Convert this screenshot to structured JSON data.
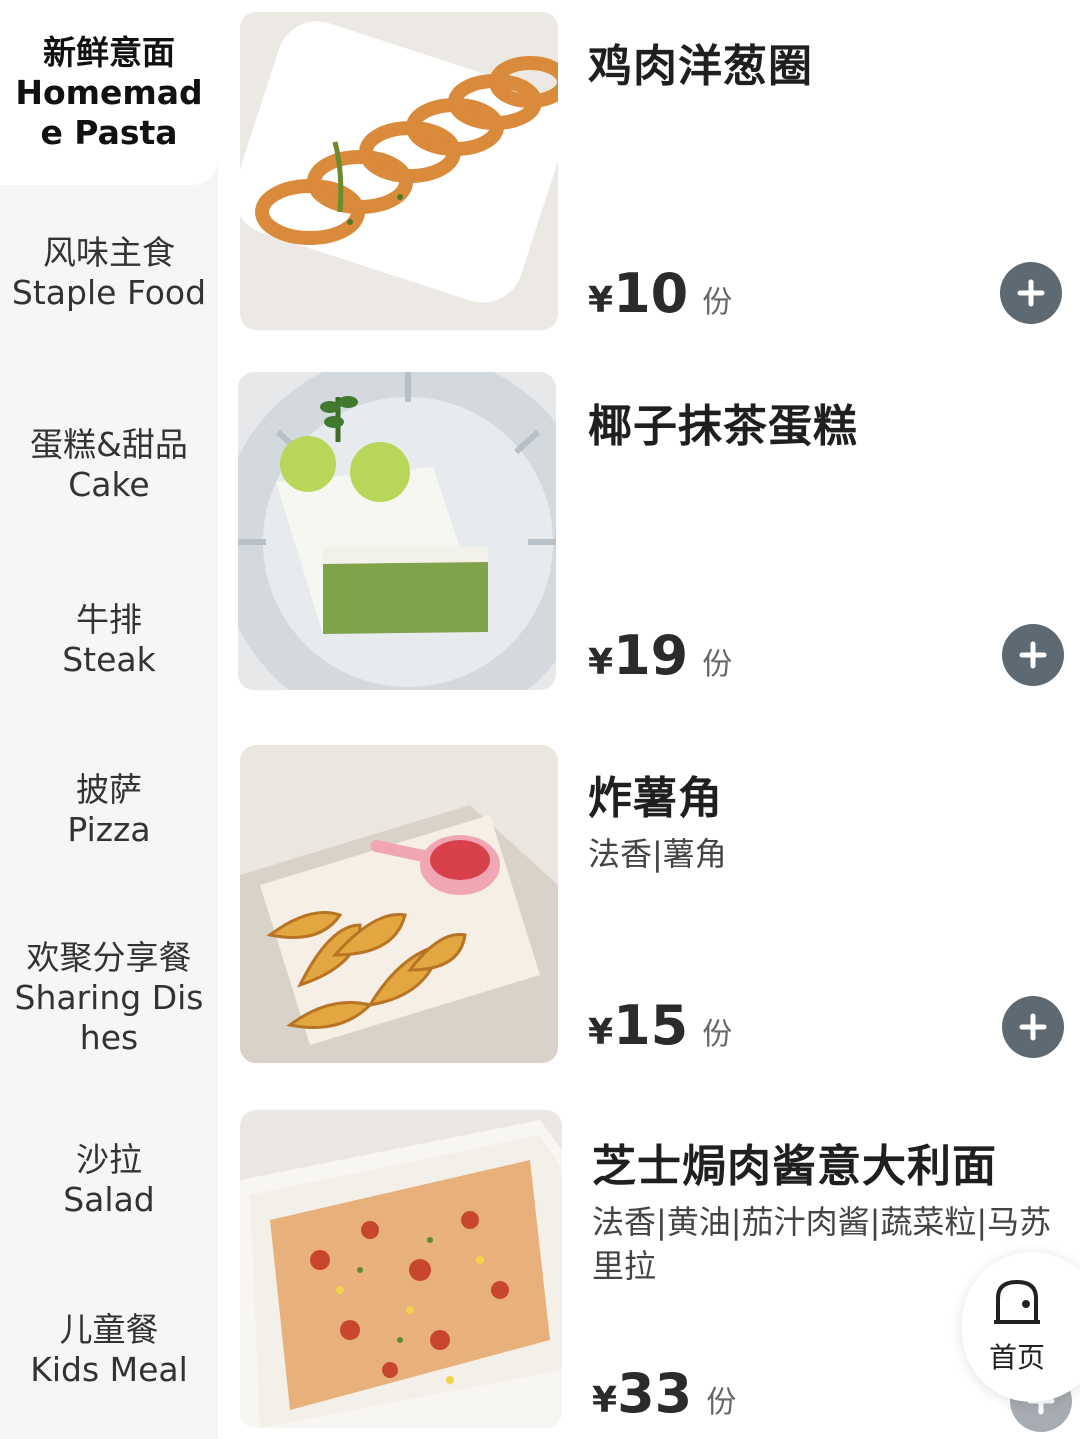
{
  "sidebar": {
    "categories": [
      {
        "zh": "新鲜意面",
        "en": "Homemade Pasta"
      },
      {
        "zh": "风味主食",
        "en": "Staple Food"
      },
      {
        "zh": "蛋糕&甜品",
        "en": "Cake"
      },
      {
        "zh": "牛排",
        "en": "Steak"
      },
      {
        "zh": "披萨",
        "en": "Pizza"
      },
      {
        "zh": "欢聚分享餐",
        "en": "Sharing Dishes"
      },
      {
        "zh": "沙拉",
        "en": "Salad"
      },
      {
        "zh": "儿童餐",
        "en": "Kids Meal"
      }
    ],
    "active_index": 0
  },
  "products": [
    {
      "name": "鸡肉洋葱圈",
      "desc": "",
      "currency": "¥",
      "price": "10",
      "unit": "份",
      "image_icon": "onion-rings-photo"
    },
    {
      "name": "椰子抹茶蛋糕",
      "desc": "",
      "currency": "¥",
      "price": "19",
      "unit": "份",
      "image_icon": "matcha-cake-photo"
    },
    {
      "name": "炸薯角",
      "desc": "法香|薯角",
      "currency": "¥",
      "price": "15",
      "unit": "份",
      "image_icon": "potato-wedges-photo"
    },
    {
      "name": "芝士焗肉酱意大利面",
      "desc": "法香|黄油|茄汁肉酱|蔬菜粒|马苏里拉",
      "currency": "¥",
      "price": "33",
      "unit": "份",
      "image_icon": "lasagna-photo"
    }
  ],
  "home_button": {
    "label": "首页",
    "icon": "home-icon"
  },
  "colors": {
    "sidebar_bg": "#f5f6f8",
    "add_button": "#5e6a73",
    "text_dark": "#1f1f1f"
  }
}
